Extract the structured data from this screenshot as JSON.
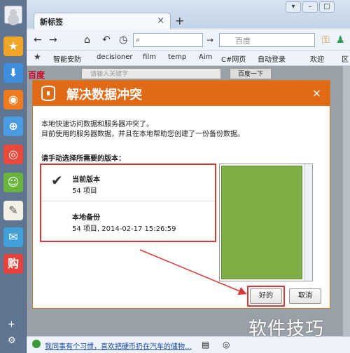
{
  "browser": {
    "tab_title": "新标签",
    "tab_close": "×",
    "new_tab": "+",
    "search_placeholder": "百度",
    "bookmarks": [
      "智能安防",
      "decisioner",
      "film",
      "temp",
      "Aim",
      "C#网页",
      "自动登录",
      "欢迎",
      "区"
    ],
    "bookmark_icon": "star-icon"
  },
  "page": {
    "baidu_logo": "百度",
    "baidu_search_placeholder": "请输入关键字",
    "baidu_button": "百度一下",
    "status_news": "我同事有个习惯，喜欢把硬币扔在汽车的储物..."
  },
  "dialog": {
    "title": "解决数据冲突",
    "close": "×",
    "desc_line1": "本地快速访问数据和服务器冲突了。",
    "desc_line2": "目前使用的服务器数据，并且在本地帮助您创建了一份备份数据。",
    "prompt": "请手动选择所需要的版本：",
    "versions": [
      {
        "title": "当前版本",
        "detail": "54 项目",
        "checked": true
      },
      {
        "title": "本地备份",
        "detail": "54 项目, 2014-02-17 15:26:59",
        "checked": false
      }
    ],
    "ok_label": "好的",
    "cancel_label": "取消",
    "accent": "#e16a17"
  },
  "watermark": "软件技巧"
}
